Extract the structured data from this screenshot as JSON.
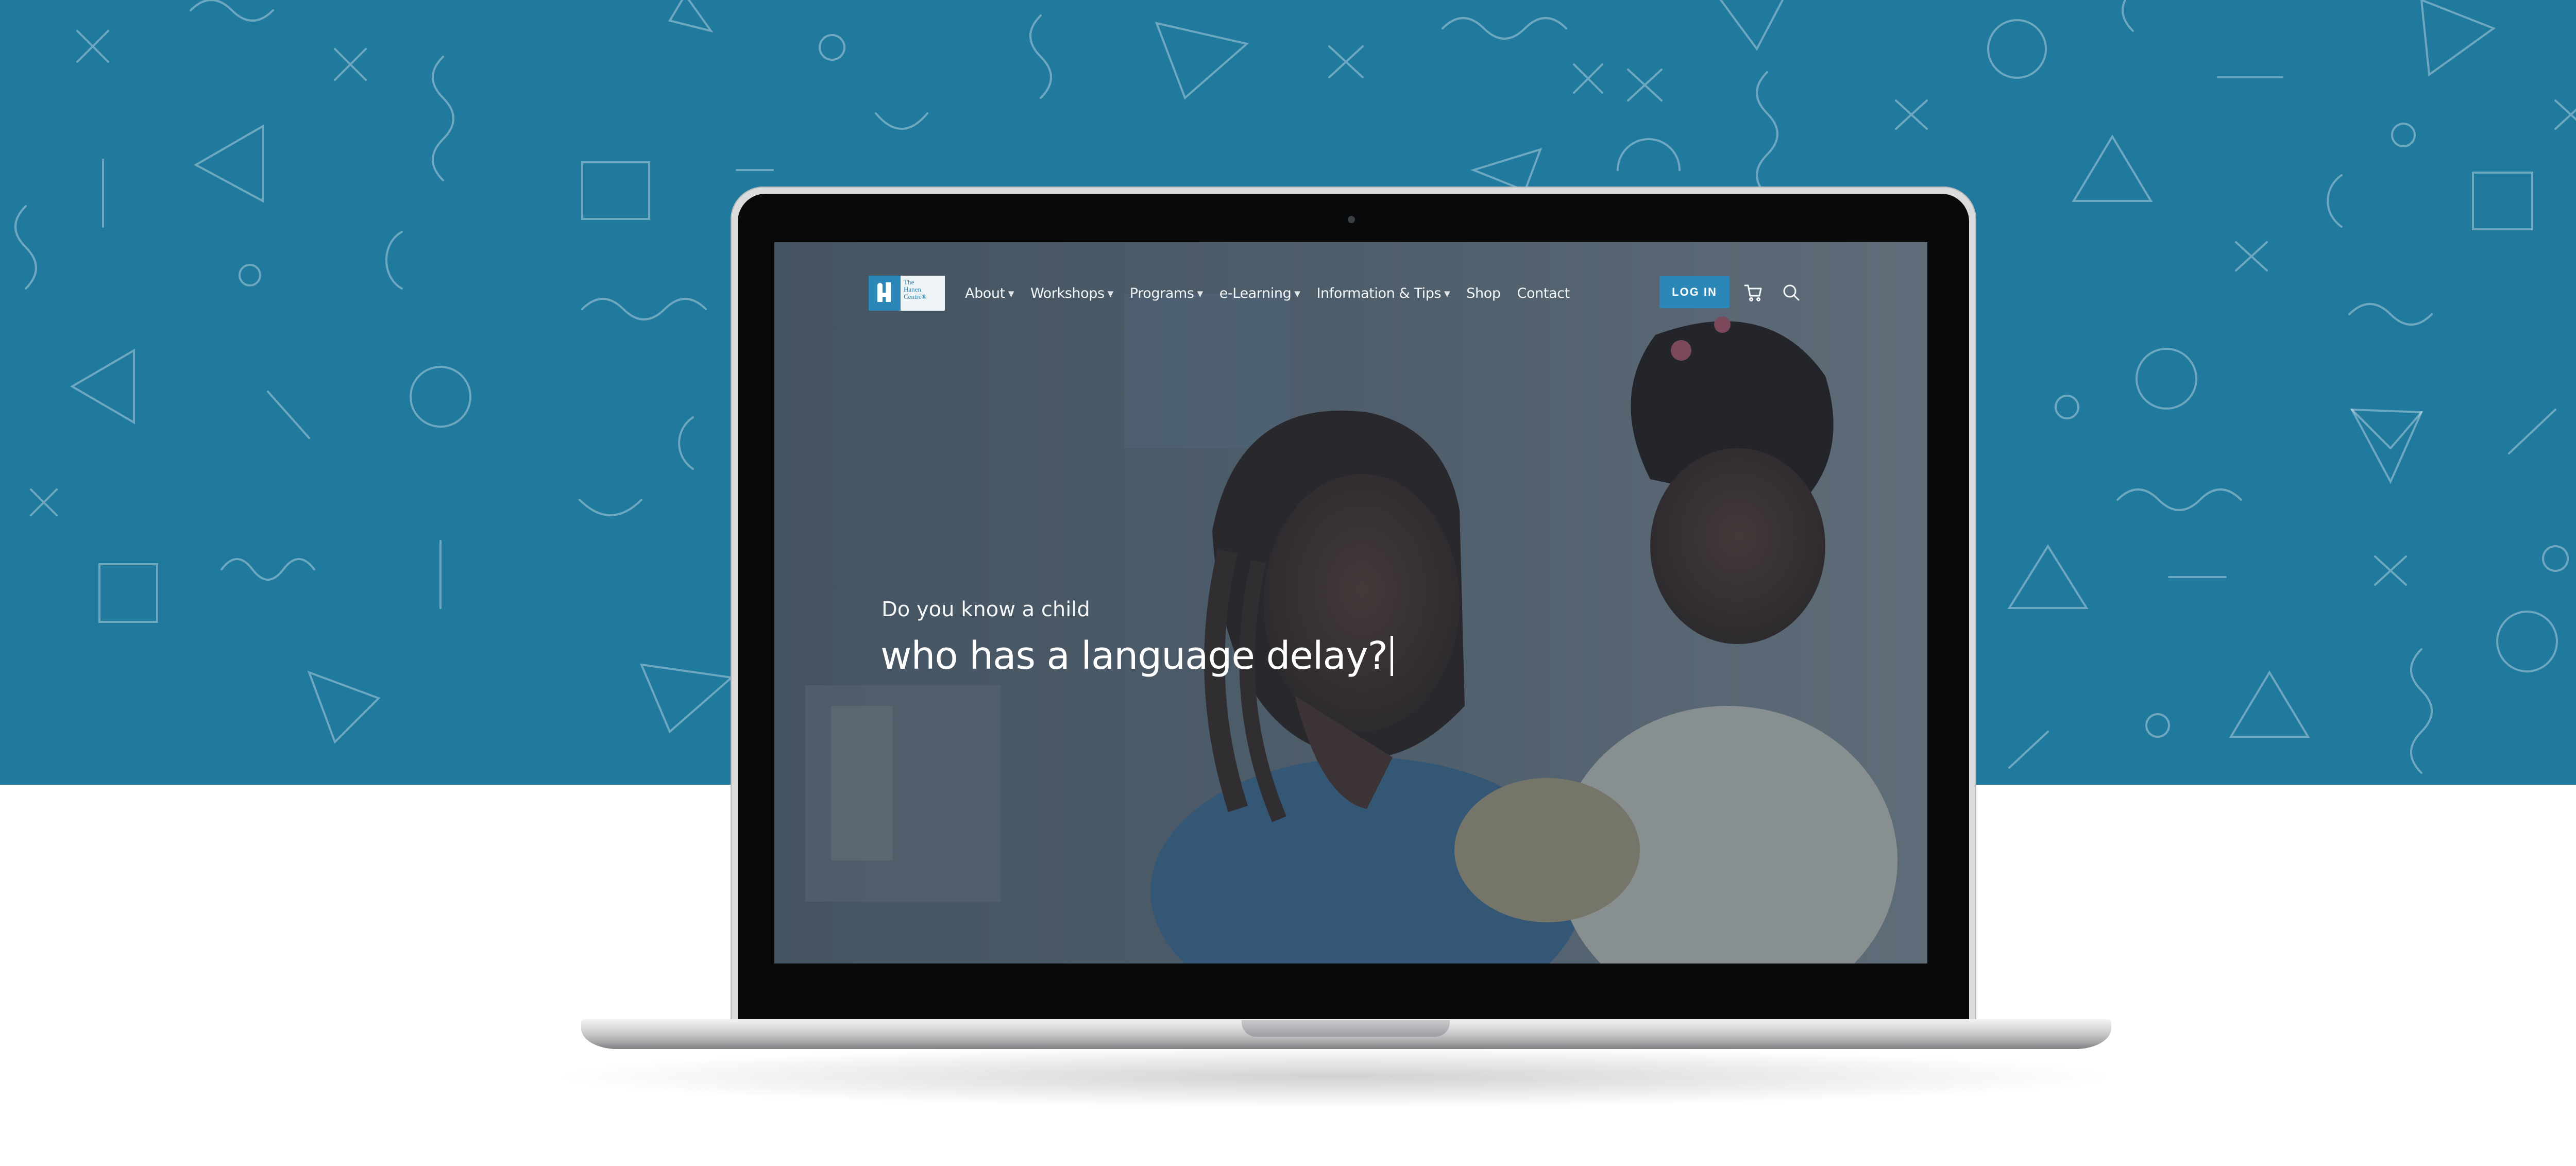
{
  "colors": {
    "background": "#207a9e",
    "accent": "#2a87b8",
    "nav_text": "#f2f5f7"
  },
  "site": {
    "logo": {
      "icon": "logo-mark-icon",
      "text": [
        "The",
        "Hanen",
        "Centre®"
      ]
    },
    "nav": {
      "items": [
        {
          "label": "About",
          "has_dropdown": true
        },
        {
          "label": "Workshops",
          "has_dropdown": true
        },
        {
          "label": "Programs",
          "has_dropdown": true
        },
        {
          "label": "e-Learning",
          "has_dropdown": true
        },
        {
          "label": "Information & Tips",
          "has_dropdown": true
        },
        {
          "label": "Shop",
          "has_dropdown": false
        },
        {
          "label": "Contact",
          "has_dropdown": false
        }
      ],
      "login_label": "LOG IN",
      "cart_icon": "cart-icon",
      "search_icon": "search-icon"
    },
    "hero": {
      "kicker": "Do you know a child",
      "headline": "who has a language delay?"
    }
  }
}
